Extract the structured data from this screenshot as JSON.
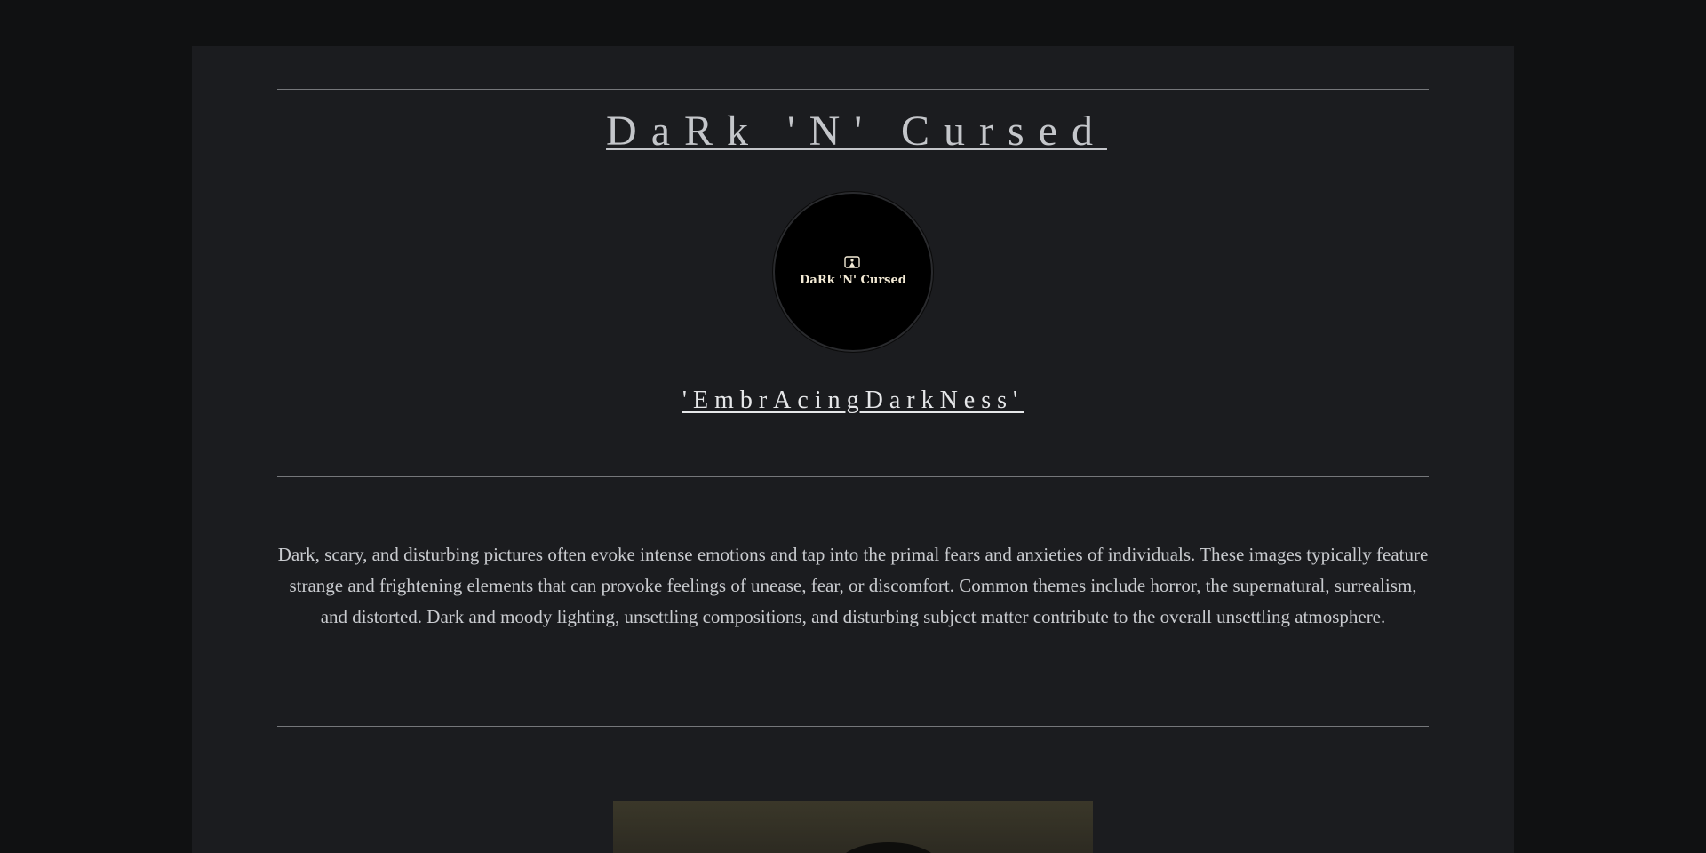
{
  "site": {
    "title": "DaRk 'N' Cursed",
    "tagline": "'EmbrAcingDarkNess'"
  },
  "logo": {
    "text": "DaRk 'N' Cursed",
    "icon": "framed-figure-icon"
  },
  "intro": {
    "text": "Dark, scary, and disturbing pictures often evoke intense emotions and tap into the primal fears and anxieties of individuals. These images typically feature strange and frightening elements that can provoke feelings of unease, fear, or discomfort. Common themes include horror, the supernatural, surrealism, and distorted. Dark and moody lighting, unsettling compositions, and disturbing subject matter contribute to the overall unsettling atmosphere."
  },
  "colors": {
    "outer_background": "#101112",
    "page_background": "#1b1c1f",
    "text": "#c9cbcf",
    "logo_text": "#f3ead5"
  }
}
